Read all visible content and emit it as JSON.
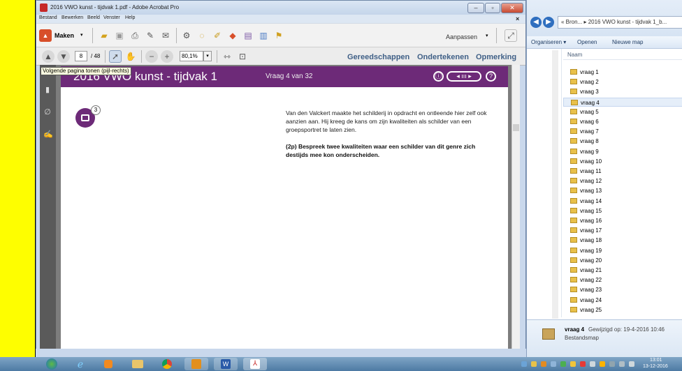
{
  "acrobat": {
    "title": "2016 VWO kunst - tijdvak 1.pdf - Adobe Acrobat Pro",
    "menus": [
      "Bestand",
      "Bewerken",
      "Beeld",
      "Venster",
      "Help"
    ],
    "close_x": "×",
    "maken": "Maken",
    "aanpassen": "Aanpassen",
    "page_current": "8",
    "page_total": "/ 48",
    "zoom": "80,1%",
    "right_links": [
      "Gereedschappen",
      "Ondertekenen",
      "Opmerking"
    ],
    "tooltip": "Volgende pagina tonen (pijl-rechts)"
  },
  "doc": {
    "header_title": "2016 VWO kunst - tijdvak 1",
    "question_counter": "Vraag 4 van 32",
    "badge": "3",
    "question_text": "Van den Valckert maakte het schilderij in opdracht en ontleende hier zelf ook aanzien aan. Hij kreeg de kans om zijn kwaliteiten als schilder van een groepsportret te laten zien.",
    "question_bold": "(2p) Bespreek twee kwaliteiten waar een schilder van dit genre zich destijds mee kon onderscheiden."
  },
  "explorer": {
    "address": "« Bron... ▸ 2016 VWO kunst - tijdvak 1_b...",
    "cmd_organiseren": "Organiseren ▾",
    "cmd_openen": "Openen",
    "cmd_nieuwe_map": "Nieuwe map",
    "col_naam": "Naam",
    "items": [
      "vraag 1",
      "vraag 2",
      "vraag 3",
      "vraag 4",
      "vraag 5",
      "vraag 6",
      "vraag 7",
      "vraag 8",
      "vraag 9",
      "vraag 10",
      "vraag 11",
      "vraag 12",
      "vraag 13",
      "vraag 14",
      "vraag 15",
      "vraag 16",
      "vraag 17",
      "vraag 18",
      "vraag 19",
      "vraag 20",
      "vraag 21",
      "vraag 22",
      "vraag 23",
      "vraag 24",
      "vraag 25"
    ],
    "selected_index": 3,
    "detail_name": "vraag 4",
    "detail_modified": "Gewijzigd op: 19-4-2016 10:46",
    "detail_type": "Bestandsmap"
  },
  "taskbar": {
    "time": "13:01",
    "date": "13-12-2016"
  }
}
